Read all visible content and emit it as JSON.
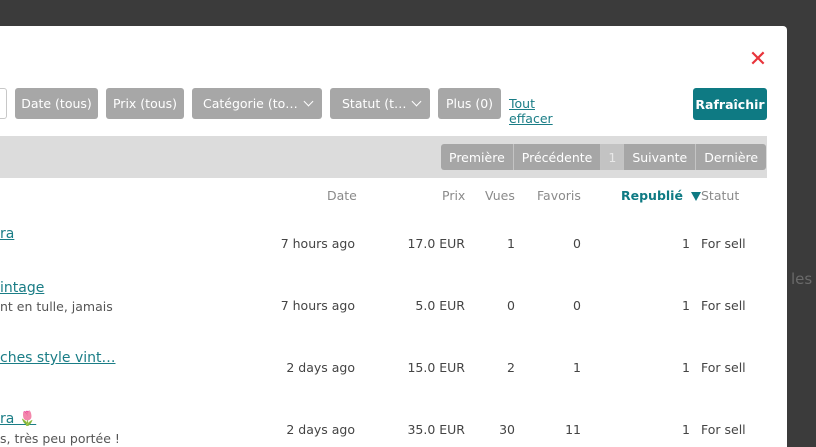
{
  "background": {
    "side_text": "les"
  },
  "modal": {
    "close_glyph": "✕",
    "filters": {
      "date": "Date (tous)",
      "price": "Prix (tous)",
      "category": "Catégorie (to…",
      "status": "Statut (t…",
      "more": "Plus (0)",
      "clear_all": "Tout effacer"
    },
    "refresh_label": "Rafraîchir",
    "pagination": {
      "first": "Première",
      "previous": "Précédente",
      "current_page": "1",
      "next": "Suivante",
      "last": "Dernière"
    },
    "columns": {
      "date": "Date",
      "price": "Prix",
      "views": "Vues",
      "favorites": "Favoris",
      "republished": "Republié",
      "status": "Statut"
    },
    "rows": [
      {
        "title": "ra",
        "subtitle": "",
        "date": "7 hours ago",
        "price": "17.0 EUR",
        "views": "1",
        "favorites": "0",
        "republished": "1",
        "status": "For sell"
      },
      {
        "title": "intage",
        "subtitle": "nt en tulle, jamais",
        "date": "7 hours ago",
        "price": "5.0 EUR",
        "views": "0",
        "favorites": "0",
        "republished": "1",
        "status": "For sell"
      },
      {
        "title": "ches style vint…",
        "subtitle": "",
        "date": "2 days ago",
        "price": "15.0 EUR",
        "views": "2",
        "favorites": "1",
        "republished": "1",
        "status": "For sell"
      },
      {
        "title": "ra 🌷",
        "subtitle": "s, très peu portée !",
        "date": "2 days ago",
        "price": "35.0 EUR",
        "views": "30",
        "favorites": "11",
        "republished": "1",
        "status": "For sell"
      }
    ]
  },
  "colors": {
    "accent": "#0e7a83",
    "link": "#1a7d86",
    "close": "#e8343b",
    "pill": "#a7a7a7",
    "pager_bar": "#dcdcdc"
  }
}
